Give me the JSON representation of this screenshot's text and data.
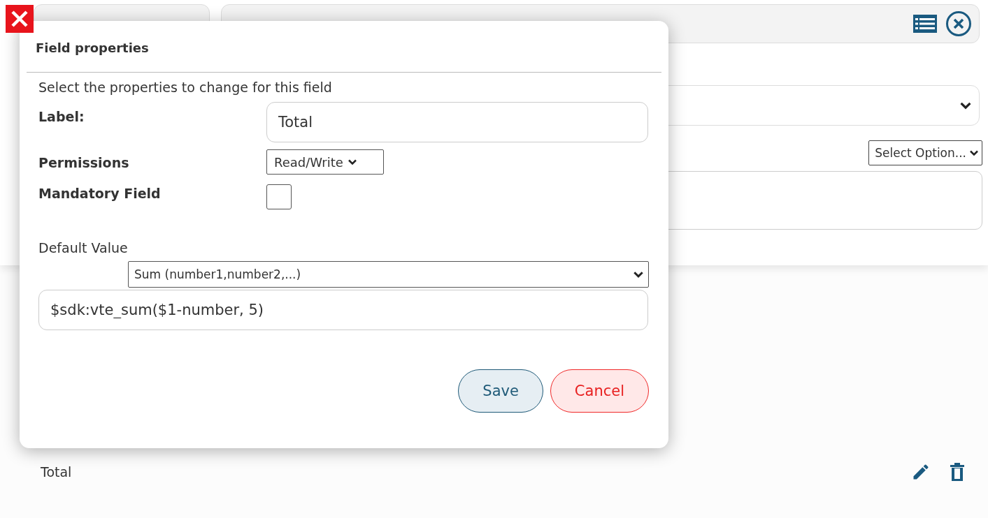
{
  "background": {
    "option_select": {
      "value": "Select Option..."
    },
    "rows": [
      {
        "label": "Total"
      }
    ]
  },
  "dialog": {
    "title": "Field properties",
    "intro": "Select the properties to change for this field",
    "label_field": {
      "label": "Label:",
      "value": "Total"
    },
    "permissions": {
      "label": "Permissions",
      "value": "Read/Write"
    },
    "mandatory": {
      "label": "Mandatory Field",
      "checked": false
    },
    "default_value": {
      "label": "Default Value",
      "function": "Sum (number1,number2,...)",
      "value": "$sdk:vte_sum($1-number, 5)"
    },
    "buttons": [
      {
        "kind": "save",
        "label": "Save"
      },
      {
        "kind": "cancel",
        "label": "Cancel"
      }
    ]
  }
}
